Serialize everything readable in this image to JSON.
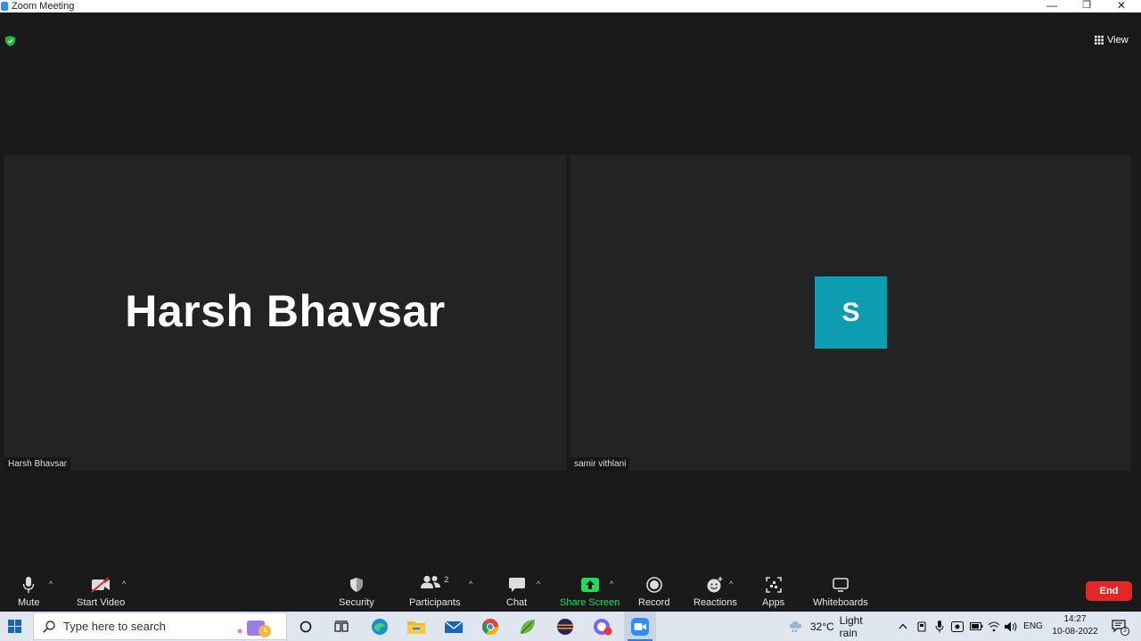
{
  "window": {
    "title": "Zoom Meeting",
    "minimize": "—",
    "restore": "❐",
    "close": "✕"
  },
  "topbar": {
    "view_label": "View"
  },
  "tiles": [
    {
      "display_name_big": "Harsh Bhavsar",
      "name_tag": "Harsh Bhavsar"
    },
    {
      "avatar_letter": "S",
      "name_tag": "samir vithlani",
      "avatar_color": "#0e9cb2"
    }
  ],
  "toolbar": {
    "mute": "Mute",
    "start_video": "Start Video",
    "security": "Security",
    "participants": "Participants",
    "participants_count": "2",
    "chat": "Chat",
    "share_screen": "Share Screen",
    "record": "Record",
    "reactions": "Reactions",
    "apps": "Apps",
    "whiteboards": "Whiteboards",
    "end": "End"
  },
  "taskbar": {
    "search_placeholder": "Type here to search",
    "weather_temp": "32°C",
    "weather_text": "Light rain",
    "language": "ENG",
    "time": "14:27",
    "date": "10-08-2022",
    "notification_count": "3"
  },
  "colors": {
    "accent_green": "#23d959",
    "end_red": "#e02828",
    "avatar_teal": "#0e9cb2"
  }
}
